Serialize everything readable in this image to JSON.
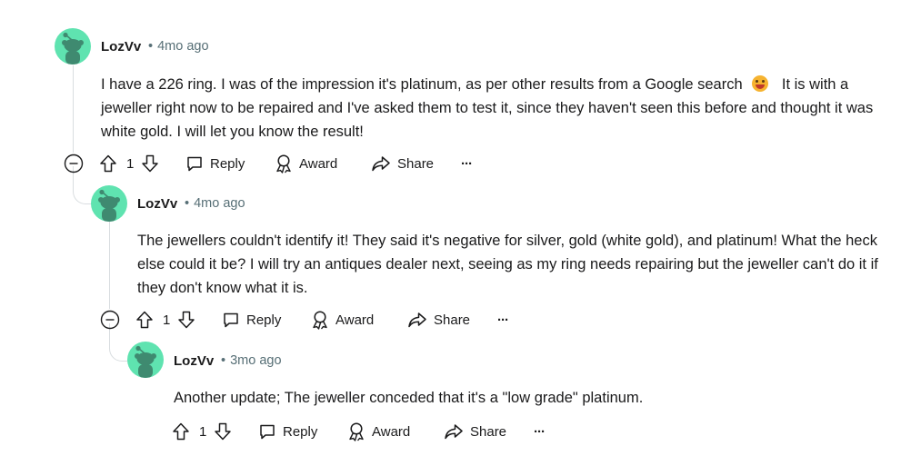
{
  "comments": [
    {
      "username": "LozVv",
      "time": "4mo ago",
      "text_before_emoji": "I have a 226 ring. I was of the impression it's platinum, as per other results from a Google search",
      "text_after_emoji": "It is with a jeweller right now to be repaired and I've asked them to test it, since they haven't seen this before and thought it was white gold. I will let you know the result!",
      "vote_count": "1",
      "reply_label": "Reply",
      "award_label": "Award",
      "share_label": "Share",
      "more_label": "···"
    },
    {
      "username": "LozVv",
      "time": "4mo ago",
      "text": "The jewellers couldn't identify it! They said it's negative for silver, gold (white gold), and platinum! What the heck else could it be? I will try an antiques dealer next, seeing as my ring needs repairing but the jeweller can't do it if they don't know what it is.",
      "vote_count": "1",
      "reply_label": "Reply",
      "award_label": "Award",
      "share_label": "Share",
      "more_label": "···"
    },
    {
      "username": "LozVv",
      "time": "3mo ago",
      "text": "Another update; The jeweller conceded that it's a \"low grade\" platinum.",
      "vote_count": "1",
      "reply_label": "Reply",
      "award_label": "Award",
      "share_label": "Share",
      "more_label": "···"
    }
  ],
  "separator": "•",
  "icons": {
    "avatar": "snoo-avatar-icon",
    "collapse": "collapse-minus-icon",
    "upvote": "upvote-arrow-icon",
    "downvote": "downvote-arrow-icon",
    "reply": "comment-bubble-icon",
    "award": "award-ribbon-icon",
    "share": "share-arrow-icon"
  },
  "colors": {
    "avatar_bg": "#5fe3b0",
    "avatar_snoo": "#3f8a70",
    "meta_text": "#576f76",
    "thread_line": "#d9dde0"
  }
}
